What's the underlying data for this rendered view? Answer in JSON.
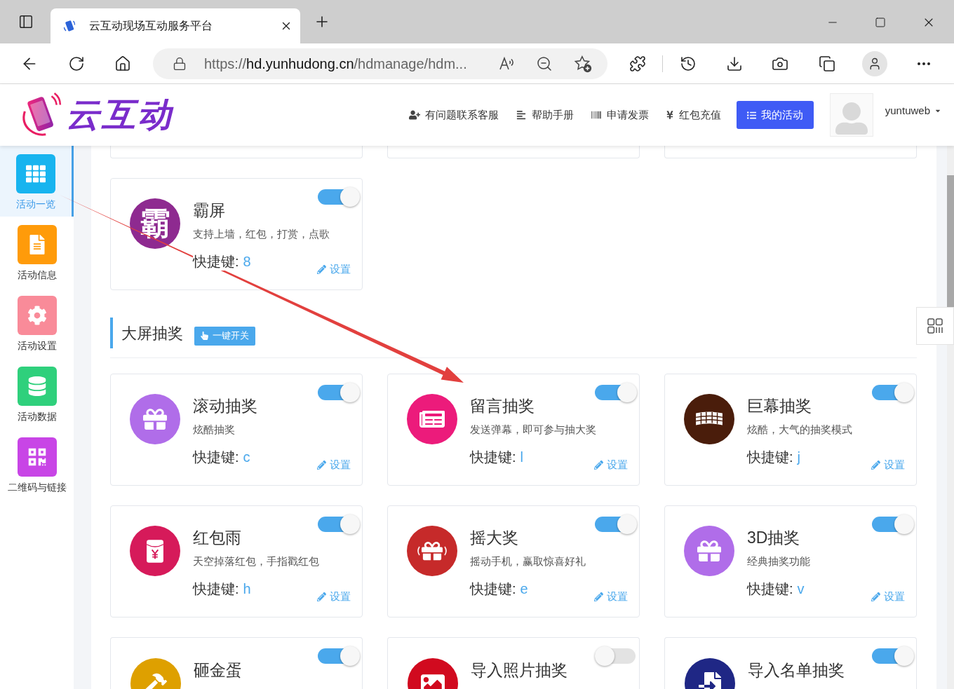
{
  "browser": {
    "tab_title": "云互动现场互动服务平台",
    "url": {
      "scheme": "https://",
      "host": "hd.yunhudong.cn",
      "path": "/hdmanage/hdm..."
    }
  },
  "header": {
    "logo_text": "云互动",
    "nav": [
      {
        "label": "有问题联系客服"
      },
      {
        "label": "帮助手册"
      },
      {
        "label": "申请发票"
      },
      {
        "label": "红包充值"
      }
    ],
    "my_activities_button": "我的活动",
    "username": "yuntuweb"
  },
  "sidebar": {
    "items": [
      {
        "label": "活动一览",
        "selected": true,
        "color": "#18b4ef"
      },
      {
        "label": "活动信息",
        "selected": false,
        "color": "#ff9b0a"
      },
      {
        "label": "活动设置",
        "selected": false,
        "color": "#f98b99"
      },
      {
        "label": "活动数据",
        "selected": false,
        "color": "#2fd07c"
      },
      {
        "label": "二维码与链接",
        "selected": false,
        "color": "#c845e6"
      }
    ]
  },
  "sections": [
    {
      "cards": [
        {
          "title": "霸屏",
          "badge_text": "霸",
          "description": "支持上墙，红包，打赏，点歌",
          "shortcut_label": "快捷键:",
          "shortcut_key": "8",
          "settings_label": "设置",
          "on": true,
          "color": "#8e2a90"
        }
      ]
    },
    {
      "title": "大屏抽奖",
      "toggle_all_button": "一键开关",
      "cards": [
        {
          "title": "滚动抽奖",
          "description": "炫酷抽奖",
          "shortcut_label": "快捷键:",
          "shortcut_key": "c",
          "settings_label": "设置",
          "on": true,
          "color": "#b06de9"
        },
        {
          "title": "留言抽奖",
          "description": "发送弹幕，即可参与抽大奖",
          "shortcut_label": "快捷键:",
          "shortcut_key": "l",
          "settings_label": "设置",
          "on": true,
          "color": "#ec1b7b"
        },
        {
          "title": "巨幕抽奖",
          "description": "炫酷，大气的抽奖模式",
          "shortcut_label": "快捷键:",
          "shortcut_key": "j",
          "settings_label": "设置",
          "on": true,
          "color": "#4a1d0b"
        },
        {
          "title": "红包雨",
          "description": "天空掉落红包，手指戳红包",
          "shortcut_label": "快捷键:",
          "shortcut_key": "h",
          "settings_label": "设置",
          "on": true,
          "color": "#d61a5a"
        },
        {
          "title": "摇大奖",
          "description": "摇动手机，赢取惊喜好礼",
          "shortcut_label": "快捷键:",
          "shortcut_key": "e",
          "settings_label": "设置",
          "on": true,
          "color": "#c62a2a"
        },
        {
          "title": "3D抽奖",
          "description": "经典抽奖功能",
          "shortcut_label": "快捷键:",
          "shortcut_key": "v",
          "settings_label": "设置",
          "on": true,
          "color": "#b06de9"
        },
        {
          "title": "砸金蛋",
          "on": true,
          "color": "#dea000"
        },
        {
          "title": "导入照片抽奖",
          "on": false,
          "color": "#d10a1f"
        },
        {
          "title": "导入名单抽奖",
          "on": true,
          "color": "#1f2785"
        }
      ]
    }
  ]
}
